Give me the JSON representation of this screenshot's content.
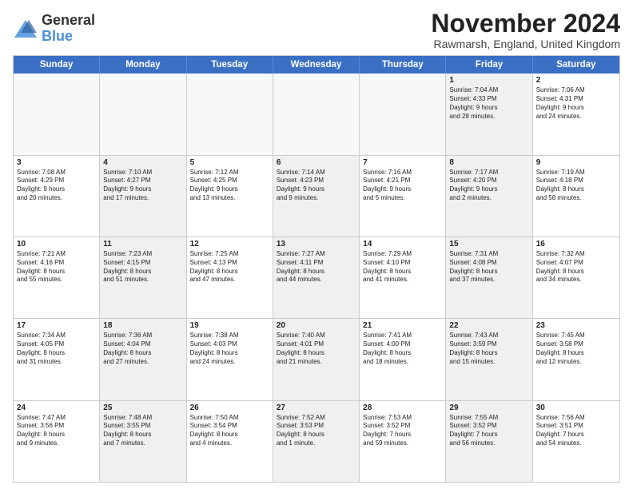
{
  "logo": {
    "general": "General",
    "blue": "Blue"
  },
  "title": "November 2024",
  "location": "Rawmarsh, England, United Kingdom",
  "days": [
    "Sunday",
    "Monday",
    "Tuesday",
    "Wednesday",
    "Thursday",
    "Friday",
    "Saturday"
  ],
  "weeks": [
    [
      {
        "day": "",
        "text": "",
        "empty": true
      },
      {
        "day": "",
        "text": "",
        "empty": true
      },
      {
        "day": "",
        "text": "",
        "empty": true
      },
      {
        "day": "",
        "text": "",
        "empty": true
      },
      {
        "day": "",
        "text": "",
        "empty": true
      },
      {
        "day": "1",
        "text": "Sunrise: 7:04 AM\nSunset: 4:33 PM\nDaylight: 9 hours\nand 28 minutes.",
        "shaded": true
      },
      {
        "day": "2",
        "text": "Sunrise: 7:06 AM\nSunset: 4:31 PM\nDaylight: 9 hours\nand 24 minutes.",
        "shaded": false
      }
    ],
    [
      {
        "day": "3",
        "text": "Sunrise: 7:08 AM\nSunset: 4:29 PM\nDaylight: 9 hours\nand 20 minutes.",
        "shaded": false
      },
      {
        "day": "4",
        "text": "Sunrise: 7:10 AM\nSunset: 4:27 PM\nDaylight: 9 hours\nand 17 minutes.",
        "shaded": true
      },
      {
        "day": "5",
        "text": "Sunrise: 7:12 AM\nSunset: 4:25 PM\nDaylight: 9 hours\nand 13 minutes.",
        "shaded": false
      },
      {
        "day": "6",
        "text": "Sunrise: 7:14 AM\nSunset: 4:23 PM\nDaylight: 9 hours\nand 9 minutes.",
        "shaded": true
      },
      {
        "day": "7",
        "text": "Sunrise: 7:16 AM\nSunset: 4:21 PM\nDaylight: 9 hours\nand 5 minutes.",
        "shaded": false
      },
      {
        "day": "8",
        "text": "Sunrise: 7:17 AM\nSunset: 4:20 PM\nDaylight: 9 hours\nand 2 minutes.",
        "shaded": true
      },
      {
        "day": "9",
        "text": "Sunrise: 7:19 AM\nSunset: 4:18 PM\nDaylight: 8 hours\nand 58 minutes.",
        "shaded": false
      }
    ],
    [
      {
        "day": "10",
        "text": "Sunrise: 7:21 AM\nSunset: 4:16 PM\nDaylight: 8 hours\nand 55 minutes.",
        "shaded": false
      },
      {
        "day": "11",
        "text": "Sunrise: 7:23 AM\nSunset: 4:15 PM\nDaylight: 8 hours\nand 51 minutes.",
        "shaded": true
      },
      {
        "day": "12",
        "text": "Sunrise: 7:25 AM\nSunset: 4:13 PM\nDaylight: 8 hours\nand 47 minutes.",
        "shaded": false
      },
      {
        "day": "13",
        "text": "Sunrise: 7:27 AM\nSunset: 4:11 PM\nDaylight: 8 hours\nand 44 minutes.",
        "shaded": true
      },
      {
        "day": "14",
        "text": "Sunrise: 7:29 AM\nSunset: 4:10 PM\nDaylight: 8 hours\nand 41 minutes.",
        "shaded": false
      },
      {
        "day": "15",
        "text": "Sunrise: 7:31 AM\nSunset: 4:08 PM\nDaylight: 8 hours\nand 37 minutes.",
        "shaded": true
      },
      {
        "day": "16",
        "text": "Sunrise: 7:32 AM\nSunset: 4:07 PM\nDaylight: 8 hours\nand 34 minutes.",
        "shaded": false
      }
    ],
    [
      {
        "day": "17",
        "text": "Sunrise: 7:34 AM\nSunset: 4:05 PM\nDaylight: 8 hours\nand 31 minutes.",
        "shaded": false
      },
      {
        "day": "18",
        "text": "Sunrise: 7:36 AM\nSunset: 4:04 PM\nDaylight: 8 hours\nand 27 minutes.",
        "shaded": true
      },
      {
        "day": "19",
        "text": "Sunrise: 7:38 AM\nSunset: 4:03 PM\nDaylight: 8 hours\nand 24 minutes.",
        "shaded": false
      },
      {
        "day": "20",
        "text": "Sunrise: 7:40 AM\nSunset: 4:01 PM\nDaylight: 8 hours\nand 21 minutes.",
        "shaded": true
      },
      {
        "day": "21",
        "text": "Sunrise: 7:41 AM\nSunset: 4:00 PM\nDaylight: 8 hours\nand 18 minutes.",
        "shaded": false
      },
      {
        "day": "22",
        "text": "Sunrise: 7:43 AM\nSunset: 3:59 PM\nDaylight: 8 hours\nand 15 minutes.",
        "shaded": true
      },
      {
        "day": "23",
        "text": "Sunrise: 7:45 AM\nSunset: 3:58 PM\nDaylight: 8 hours\nand 12 minutes.",
        "shaded": false
      }
    ],
    [
      {
        "day": "24",
        "text": "Sunrise: 7:47 AM\nSunset: 3:56 PM\nDaylight: 8 hours\nand 9 minutes.",
        "shaded": false
      },
      {
        "day": "25",
        "text": "Sunrise: 7:48 AM\nSunset: 3:55 PM\nDaylight: 8 hours\nand 7 minutes.",
        "shaded": true
      },
      {
        "day": "26",
        "text": "Sunrise: 7:50 AM\nSunset: 3:54 PM\nDaylight: 8 hours\nand 4 minutes.",
        "shaded": false
      },
      {
        "day": "27",
        "text": "Sunrise: 7:52 AM\nSunset: 3:53 PM\nDaylight: 8 hours\nand 1 minute.",
        "shaded": true
      },
      {
        "day": "28",
        "text": "Sunrise: 7:53 AM\nSunset: 3:52 PM\nDaylight: 7 hours\nand 59 minutes.",
        "shaded": false
      },
      {
        "day": "29",
        "text": "Sunrise: 7:55 AM\nSunset: 3:52 PM\nDaylight: 7 hours\nand 56 minutes.",
        "shaded": true
      },
      {
        "day": "30",
        "text": "Sunrise: 7:56 AM\nSunset: 3:51 PM\nDaylight: 7 hours\nand 54 minutes.",
        "shaded": false
      }
    ]
  ]
}
